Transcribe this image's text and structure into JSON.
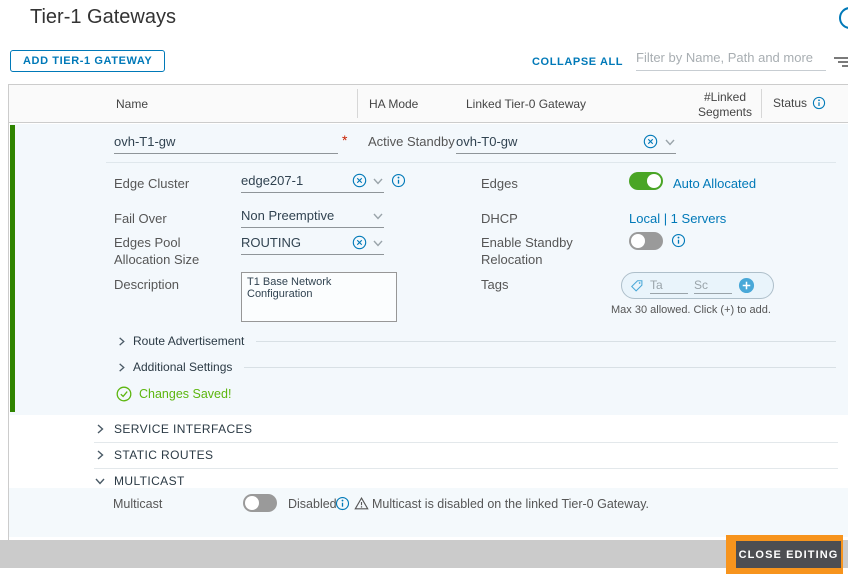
{
  "page": {
    "title": "Tier-1 Gateways"
  },
  "toolbar": {
    "add_button": "ADD TIER-1 GATEWAY",
    "collapse_all": "COLLAPSE ALL",
    "filter_placeholder": "Filter by Name, Path and more"
  },
  "table": {
    "col_name": "Name",
    "col_ha": "HA Mode",
    "col_linked": "Linked Tier-0 Gateway",
    "col_segments": "#Linked Segments",
    "col_status": "Status"
  },
  "gateway": {
    "name": "ovh-T1-gw",
    "required_marker": "*",
    "ha_mode": "Active Standby",
    "linked_tier0": "ovh-T0-gw",
    "edge_cluster_label": "Edge Cluster",
    "edge_cluster": "edge207-1",
    "fail_over_label": "Fail Over",
    "fail_over": "Non Preemptive",
    "pool_label": "Edges Pool Allocation Size",
    "pool": "ROUTING",
    "description_label": "Description",
    "description": "T1 Base Network Configuration",
    "edges_label": "Edges",
    "edges_value": "Auto Allocated",
    "dhcp_label": "DHCP",
    "dhcp_value": "Local | 1 Servers",
    "standby_label": "Enable Standby Relocation",
    "tags_label": "Tags",
    "tag_placeholder": "Ta",
    "scope_placeholder": "Sc",
    "tags_help": "Max 30 allowed. Click (+) to add.",
    "route_advertisement": "Route Advertisement",
    "additional_settings": "Additional Settings",
    "changes_saved": "Changes Saved!"
  },
  "sections": {
    "service_interfaces": "SERVICE INTERFACES",
    "static_routes": "STATIC ROUTES",
    "multicast": "MULTICAST"
  },
  "multicast": {
    "label": "Multicast",
    "state": "Disabled",
    "warning": "Multicast is disabled on the linked Tier-0 Gateway."
  },
  "footer": {
    "close_button": "CLOSE EDITING"
  },
  "colors": {
    "accent_blue": "#0079b8",
    "edit_green_bar": "#2f8400",
    "toggle_on_green": "#4aa525",
    "success_green": "#5db60f",
    "highlight_orange": "#f7941d",
    "close_button_gray": "#4d4e52",
    "panel_blue": "#f3f8fc"
  }
}
